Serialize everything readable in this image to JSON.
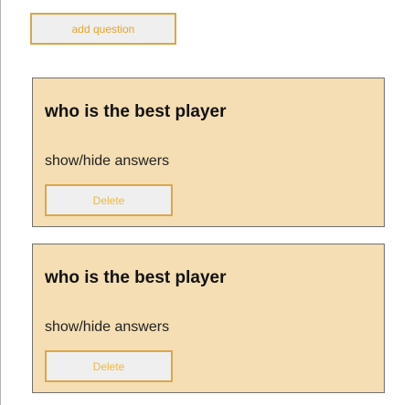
{
  "toolbar": {
    "add_question_label": "add question"
  },
  "questions": [
    {
      "title": "who is the best player",
      "toggle_label": "show/hide answers",
      "delete_label": "Delete"
    },
    {
      "title": "who is the best player",
      "toggle_label": "show/hide answers",
      "delete_label": "Delete"
    }
  ],
  "colors": {
    "card_background": "#f5deb3",
    "card_border": "#707070",
    "button_border": "#dba64a",
    "button_text": "#e3a52a",
    "button_background": "#efefef"
  }
}
